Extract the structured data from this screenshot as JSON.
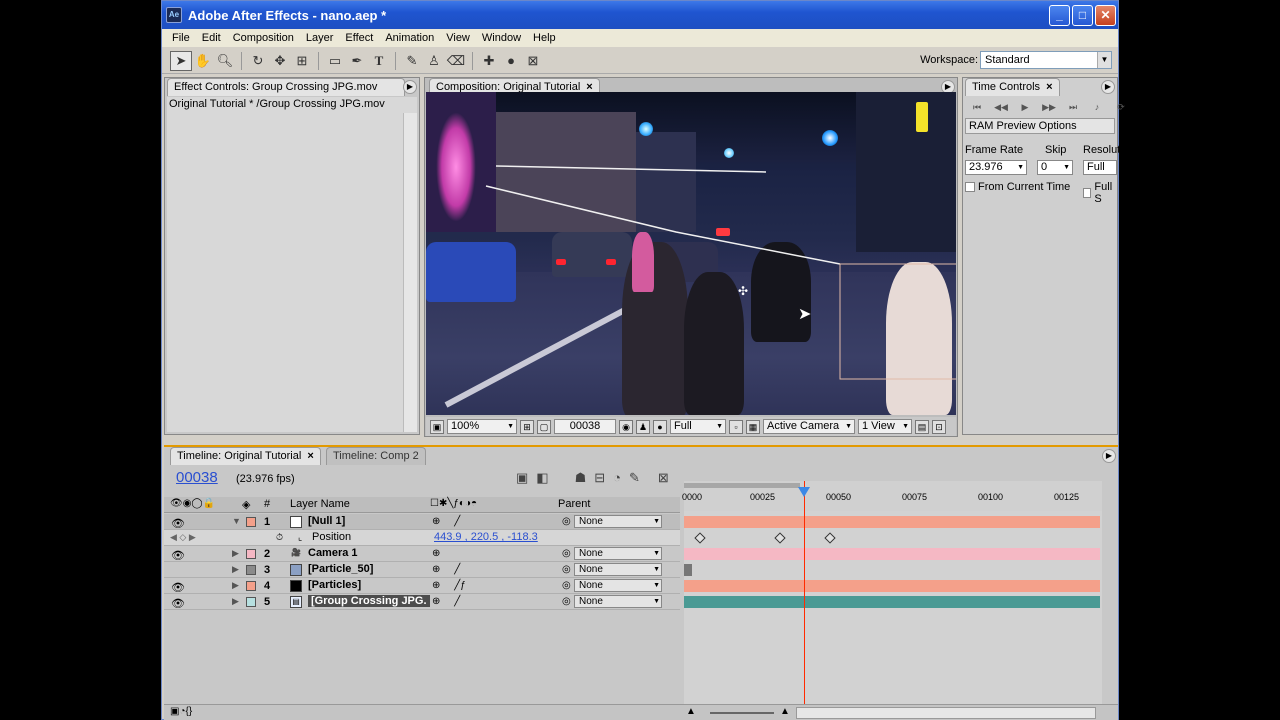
{
  "window": {
    "title": "Adobe After Effects - nano.aep *"
  },
  "menu": [
    "File",
    "Edit",
    "Composition",
    "Layer",
    "Effect",
    "Animation",
    "View",
    "Window",
    "Help"
  ],
  "workspace": {
    "label": "Workspace:",
    "value": "Standard"
  },
  "effect_controls": {
    "tab": "Effect Controls: Group Crossing JPG.mov",
    "path": "Original Tutorial * /Group Crossing JPG.mov"
  },
  "composition": {
    "tab": "Composition: Original Tutorial",
    "zoom": "100%",
    "timecode": "00038",
    "resolution": "Full",
    "camera": "Active Camera",
    "views": "1 View"
  },
  "time_controls": {
    "tab": "Time Controls",
    "ram_options": "RAM Preview Options",
    "frame_rate_label": "Frame Rate",
    "frame_rate": "23.976",
    "skip_label": "Skip",
    "skip": "0",
    "resolution_label": "Resolut",
    "resolution": "Full",
    "from_current": "From Current Time",
    "full_screen": "Full S"
  },
  "timeline": {
    "tab_active": "Timeline: Original Tutorial",
    "tab_other": "Timeline: Comp 2",
    "current_time": "00038",
    "fps": "(23.976 fps)",
    "col_num": "#",
    "col_layer": "Layer Name",
    "col_parent": "Parent",
    "ruler": [
      "0000",
      "00025",
      "00050",
      "00075",
      "00100",
      "00125"
    ],
    "layers": [
      {
        "num": "1",
        "name": "[Null 1]",
        "parent": "None"
      },
      {
        "num": "2",
        "name": "Camera 1",
        "parent": "None"
      },
      {
        "num": "3",
        "name": "[Particle_50]",
        "parent": "None"
      },
      {
        "num": "4",
        "name": "[Particles]",
        "parent": "None"
      },
      {
        "num": "5",
        "name": "[Group Crossing JPG.",
        "parent": "None"
      }
    ],
    "position": {
      "label": "Position",
      "value": "443.9 , 220.5 , -118.3"
    }
  },
  "colors": {
    "null_bar": "#f4a08a",
    "camera_bar": "#f5b8c4",
    "particles_bar": "#f4a08a",
    "footage_bar": "#4a9a94",
    "accent": "#e39a00",
    "cti": "#ff2a00"
  }
}
